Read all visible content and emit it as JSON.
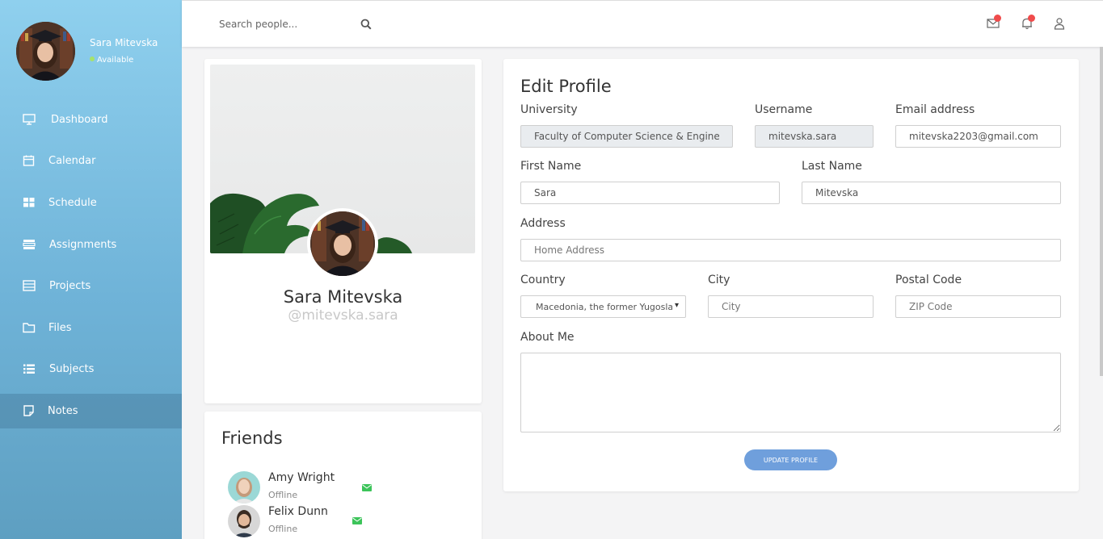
{
  "sidebar": {
    "user": {
      "name": "Sara Mitevska",
      "status": "Available"
    },
    "items": [
      {
        "label": "Dashboard",
        "icon": "monitor-icon"
      },
      {
        "label": "Calendar",
        "icon": "calendar-icon"
      },
      {
        "label": "Schedule",
        "icon": "grid-icon"
      },
      {
        "label": "Assignments",
        "icon": "list-box-icon"
      },
      {
        "label": "Projects",
        "icon": "table-icon"
      },
      {
        "label": "Files",
        "icon": "folder-icon"
      },
      {
        "label": "Subjects",
        "icon": "bullet-list-icon"
      },
      {
        "label": "Notes",
        "icon": "note-icon",
        "active": true
      }
    ]
  },
  "topbar": {
    "search_placeholder": "Search people...",
    "icons": [
      "mail-icon",
      "bell-icon",
      "user-icon"
    ],
    "badge_color": "#f04b4b"
  },
  "profile": {
    "name": "Sara Mitevska",
    "handle": "@mitevska.sara"
  },
  "friends": {
    "title": "Friends",
    "items": [
      {
        "name": "Amy Wright",
        "status": "Offline"
      },
      {
        "name": "Felix Dunn",
        "status": "Offline"
      }
    ]
  },
  "edit": {
    "title": "Edit Profile",
    "university": {
      "label": "University",
      "value": "Faculty of Computer Science & Engineering"
    },
    "username": {
      "label": "Username",
      "value": "mitevska.sara"
    },
    "email": {
      "label": "Email address",
      "value": "mitevska2203@gmail.com"
    },
    "first_name": {
      "label": "First Name",
      "value": "Sara"
    },
    "last_name": {
      "label": "Last Name",
      "value": "Mitevska"
    },
    "address": {
      "label": "Address",
      "placeholder": "Home Address"
    },
    "country": {
      "label": "Country",
      "value": "Macedonia, the former Yugoslav Republic of"
    },
    "city": {
      "label": "City",
      "placeholder": "City"
    },
    "postal": {
      "label": "Postal Code",
      "placeholder": "ZIP Code"
    },
    "about": {
      "label": "About Me"
    },
    "submit_label": "UPDATE PROFILE"
  },
  "colors": {
    "accent": "#6f9fdc",
    "sidebar_top": "#8fd0ee",
    "sidebar_bottom": "#5e9fc1",
    "online": "#a6e36b",
    "mail_green": "#3cc45a"
  }
}
